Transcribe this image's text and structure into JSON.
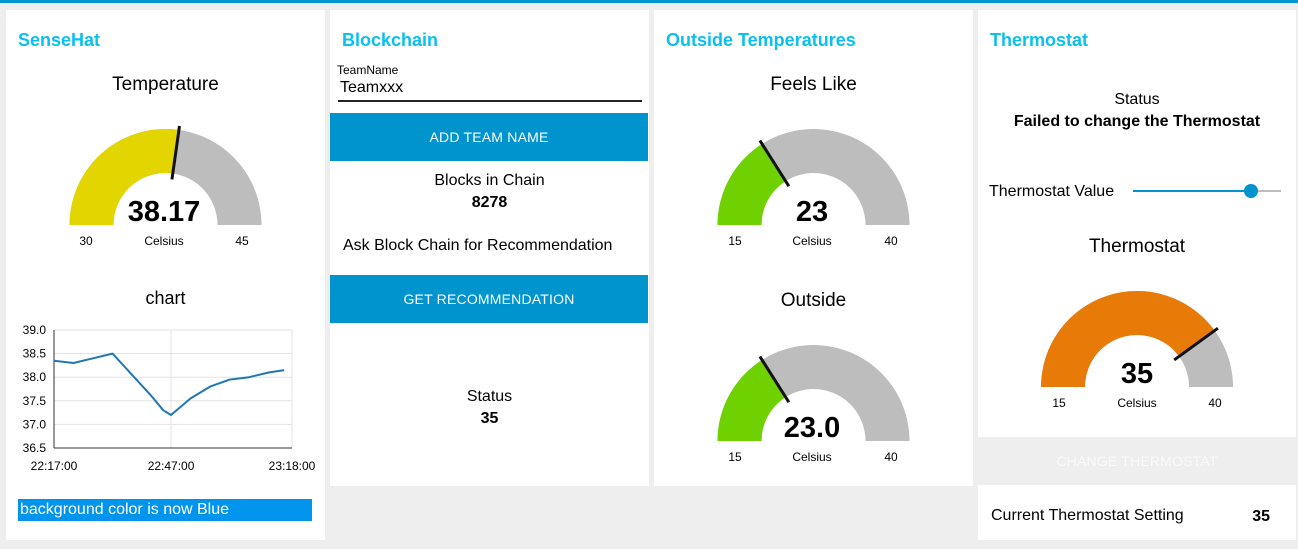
{
  "colors": {
    "accent": "#0094ce",
    "title": "#0ac0ee",
    "gauge_track": "#bdbdbd",
    "yellow": "#e2d500",
    "green": "#6fd200",
    "orange": "#e87b07",
    "line": "#1f77b4"
  },
  "sensehat": {
    "group_title": "SenseHat",
    "gauge": {
      "title": "Temperature",
      "value": "38.17",
      "value_num": 38.17,
      "units": "Celsius",
      "min": "30",
      "max": "45",
      "min_num": 30,
      "max_num": 45
    },
    "chart_title": "chart",
    "toast": "background color is now Blue"
  },
  "chart_data": {
    "type": "line",
    "title": "chart",
    "x_ticks": [
      "22:17:00",
      "22:47:00",
      "23:18:00"
    ],
    "y_ticks": [
      "39.0",
      "38.5",
      "38.0",
      "37.5",
      "37.0",
      "36.5"
    ],
    "ylim": [
      36.5,
      39.0
    ],
    "xlim": [
      "22:17:00",
      "23:18:00"
    ],
    "grid": true,
    "series": [
      {
        "x": [
          "22:17:00",
          "22:22:00",
          "22:27:00",
          "22:32:00",
          "22:37:00",
          "22:42:00",
          "22:45:00",
          "22:47:00",
          "22:52:00",
          "22:57:00",
          "23:02:00",
          "23:07:00",
          "23:12:00",
          "23:16:00"
        ],
        "values": [
          38.35,
          38.3,
          38.4,
          38.5,
          38.05,
          37.6,
          37.3,
          37.2,
          37.55,
          37.8,
          37.95,
          38.0,
          38.1,
          38.15
        ]
      }
    ]
  },
  "blockchain": {
    "group_title": "Blockchain",
    "team_label": "TeamName",
    "team_value": "Teamxxx",
    "add_button": "ADD TEAM NAME",
    "blocks_label": "Blocks in Chain",
    "blocks_value": "8278",
    "ask_label": "Ask Block Chain for Recommendation",
    "rec_button": "GET RECOMMENDATION",
    "status_label": "Status",
    "status_value": "35"
  },
  "outside": {
    "group_title": "Outside Temperatures",
    "feels": {
      "title": "Feels Like",
      "value": "23",
      "value_num": 23,
      "units": "Celsius",
      "min": "15",
      "max": "40",
      "min_num": 15,
      "max_num": 40
    },
    "outside": {
      "title": "Outside",
      "value": "23.0",
      "value_num": 23.0,
      "units": "Celsius",
      "min": "15",
      "max": "40",
      "min_num": 15,
      "max_num": 40
    }
  },
  "thermostat": {
    "group_title": "Thermostat",
    "status_label": "Status",
    "status_value": "Failed to change the Thermostat",
    "slider_label": "Thermostat Value",
    "slider_fraction": 0.8,
    "gauge": {
      "title": "Thermostat",
      "value": "35",
      "value_num": 35,
      "units": "Celsius",
      "min": "15",
      "max": "40",
      "min_num": 15,
      "max_num": 40
    },
    "change_button": "CHANGE THERMOSTAT",
    "current_label": "Current Thermostat Setting",
    "current_value": "35"
  }
}
